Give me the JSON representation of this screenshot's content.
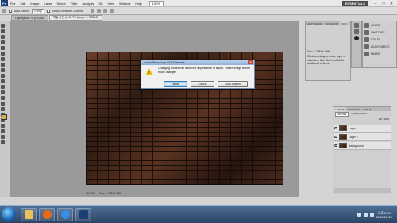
{
  "menubar": {
    "app_logo": "Ps",
    "items": [
      "File",
      "Edit",
      "Image",
      "Layer",
      "Select",
      "Filter",
      "Analysis",
      "3D",
      "View",
      "Window",
      "Help"
    ],
    "zoom": "100%",
    "workspace": "ESSENTIALS",
    "window_controls": [
      "–",
      "□",
      "✕"
    ]
  },
  "options_bar": {
    "auto_select_label": "Auto-Select:",
    "auto_select_value": "Group",
    "show_transform_label": "Show Transform Controls"
  },
  "doc_tabs": [
    {
      "label": "Layer@ 66.7% (RGB/8)",
      "active": false
    },
    {
      "label": "벽돌 사진 @ 66.7% (Layer 1, RGB/8)",
      "active": true
    }
  ],
  "status": {
    "zoom": "66.67%",
    "doc": "Doc: 1.22M/4.46M"
  },
  "dialog": {
    "title": "Adobe Photoshop CS4 Extended",
    "message": "Changing modes can affect the appearance of layers. Flatten image before mode change?",
    "buttons": {
      "flatten": "Flatten",
      "cancel": "Cancel",
      "dont_flatten": "Don't Flatten"
    }
  },
  "info_panel": {
    "tabs": [
      "HISTOGRAM",
      "NAVIGATOR",
      "INFO"
    ],
    "doc_line": "Doc: 1.22M/4.46M",
    "hint": "Click and drag to move layer or selection. Use Shift and Alt for additional options."
  },
  "right_dock": {
    "items": [
      "COLOR",
      "SWATCHES",
      "STYLES",
      "ADJUSTMENTS",
      "MASKS"
    ]
  },
  "layers_panel": {
    "tabs": [
      "LAYERS",
      "CHANNELS",
      "PATHS"
    ],
    "blend_mode": "Normal",
    "opacity_label": "Opacity: 100%",
    "fill_label": "Fill: 100%",
    "layers": [
      "Layer 1",
      "Layer 2",
      "Background"
    ]
  },
  "taskbar": {
    "time": "오후 2:49",
    "date": "2013-06-20"
  }
}
